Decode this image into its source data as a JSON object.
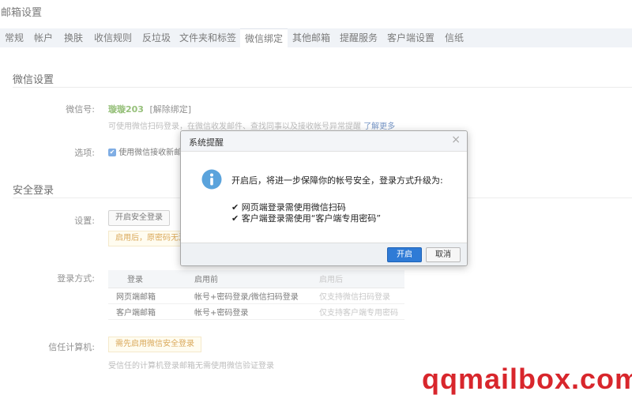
{
  "header": {
    "title": "邮箱设置"
  },
  "tabs": [
    {
      "label": "常规"
    },
    {
      "label": "帐户"
    },
    {
      "label": "换肤"
    },
    {
      "label": "收信规则"
    },
    {
      "label": "反垃圾"
    },
    {
      "label": "文件夹和标签"
    },
    {
      "label": "微信绑定"
    },
    {
      "label": "其他邮箱"
    },
    {
      "label": "提醒服务"
    },
    {
      "label": "客户端设置"
    },
    {
      "label": "信纸"
    }
  ],
  "wechat_section": {
    "title": "微信设置",
    "account_label": "微信号:",
    "account_value": "璇璇203",
    "unbind_link": "[解除绑定]",
    "hint_text": "可使用微信扫码登录，在微信收发邮件、查找同事以及接收帐号异常提醒",
    "learn_more": "了解更多",
    "option_label": "选项:",
    "option_text": "使用微信接收新邮件"
  },
  "security_section": {
    "title": "安全登录",
    "setting_label": "设置:",
    "enable_button": "开启安全登录",
    "notice_text": "启用后，原密码无法",
    "login_method_label": "登录方式:",
    "table": {
      "headers": [
        "登录",
        "启用前",
        "启用后"
      ],
      "rows": [
        [
          "网页端邮箱",
          "帐号+密码登录/微信扫码登录",
          "仅支持微信扫码登录"
        ],
        [
          "客户端邮箱",
          "帐号+密码登录",
          "仅支持客户端专用密码"
        ]
      ]
    },
    "trusted_label": "信任计算机:",
    "trusted_notice": "需先启用微信安全登录",
    "trusted_hint": "受信任的计算机登录邮箱无需使用微信验证登录"
  },
  "dialog": {
    "title": "系统提醒",
    "close_glyph": "×",
    "message": "开启后，将进一步保障你的帐号安全，登录方式升级为:",
    "items": [
      "✔ 网页端登录需使用微信扫码",
      "✔ 客户端登录需使用“客户端专用密码”"
    ],
    "confirm_label": "开启",
    "cancel_label": "取消"
  },
  "watermark": "qqmailbox.com",
  "colors": {
    "accent": "#2f7bd6",
    "green": "#5e9e33",
    "notice": "#c67a00",
    "watermark": "#d8262c"
  }
}
